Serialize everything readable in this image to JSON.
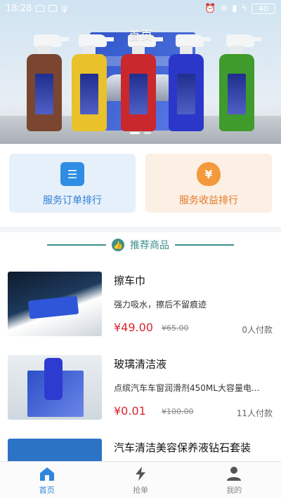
{
  "status_bar": {
    "time": "18:28",
    "battery": "40"
  },
  "page_title": "首页",
  "quick_cards": [
    {
      "label": "服务订单排行",
      "icon": "clipboard-icon"
    },
    {
      "label": "服务收益排行",
      "icon": "money-bag-icon"
    }
  ],
  "section": {
    "title": "推荐商品",
    "icon": "thumbs-up-icon"
  },
  "products": [
    {
      "name": "擦车巾",
      "desc": "强力吸水，擦后不留痕迹",
      "price": "¥49.00",
      "orig": "¥65.00",
      "paid": "0人付款"
    },
    {
      "name": "玻璃清洁液",
      "desc": "点缤汽车车窗润滑剂450ML大容量电...",
      "price": "¥0.01",
      "orig": "¥100.00",
      "paid": "11人付款"
    },
    {
      "name": "汽车清洁美容保养液钻石套装"
    }
  ],
  "nav": [
    {
      "label": "首页",
      "icon": "home-icon",
      "active": true
    },
    {
      "label": "抢单",
      "icon": "lightning-icon",
      "active": false
    },
    {
      "label": "我的",
      "icon": "user-icon",
      "active": false
    }
  ],
  "colors": {
    "accent": "#2e86de",
    "price": "#d6262c",
    "section": "#3b8f8a"
  }
}
